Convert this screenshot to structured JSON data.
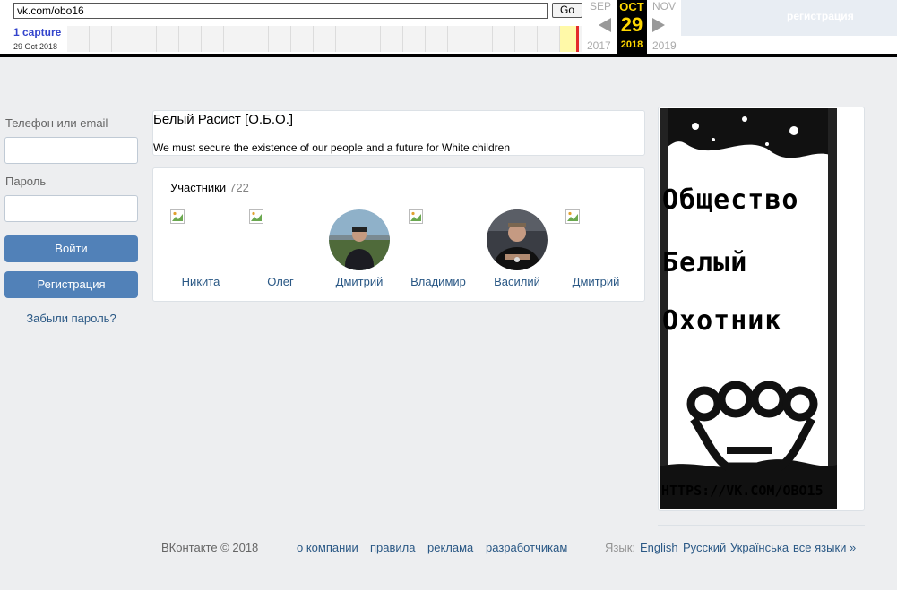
{
  "wayback": {
    "url": "vk.com/obo16",
    "go_label": "Go",
    "captures_label": "1 capture",
    "capture_date": "29 Oct 2018",
    "prev_month": "SEP",
    "cur_month": "OCT",
    "next_month": "NOV",
    "cur_day": "29",
    "prev_year": "2017",
    "cur_year": "2018",
    "next_year": "2019",
    "register_label": "регистрация"
  },
  "login": {
    "phone_label": "Телефон или email",
    "password_label": "Пароль",
    "login_button": "Войти",
    "register_button": "Регистрация",
    "forgot_link": "Забыли пароль?"
  },
  "group": {
    "title": "Белый Расист [О.Б.О.]",
    "status": "We must secure the existence of our people and a future for White children"
  },
  "members": {
    "heading": "Участники",
    "count": "722",
    "list": [
      {
        "name": "Никита",
        "avatar": "broken-image-icon"
      },
      {
        "name": "Олег",
        "avatar": "broken-image-icon"
      },
      {
        "name": "Дмитрий",
        "avatar": "photo"
      },
      {
        "name": "Владимир",
        "avatar": "broken-image-icon"
      },
      {
        "name": "Василий",
        "avatar": "photo"
      },
      {
        "name": "Дмитрий",
        "avatar": "broken-image-icon"
      }
    ]
  },
  "poster": {
    "line1": "Общество",
    "line2": "Белый",
    "line3": "Охотник",
    "url": "HTTPS://VK.COM/OBO15"
  },
  "footer": {
    "copyright": "ВКонтакте © 2018",
    "links": [
      "о компании",
      "правила",
      "реклама",
      "разработчикам"
    ],
    "lang_label": "Язык:",
    "languages": [
      "English",
      "Русский",
      "Українська",
      "все языки »"
    ]
  },
  "colors": {
    "accent": "#5181b8",
    "link": "#2a5885",
    "background": "#edeef0",
    "wayback_highlight": "#ffd700"
  }
}
